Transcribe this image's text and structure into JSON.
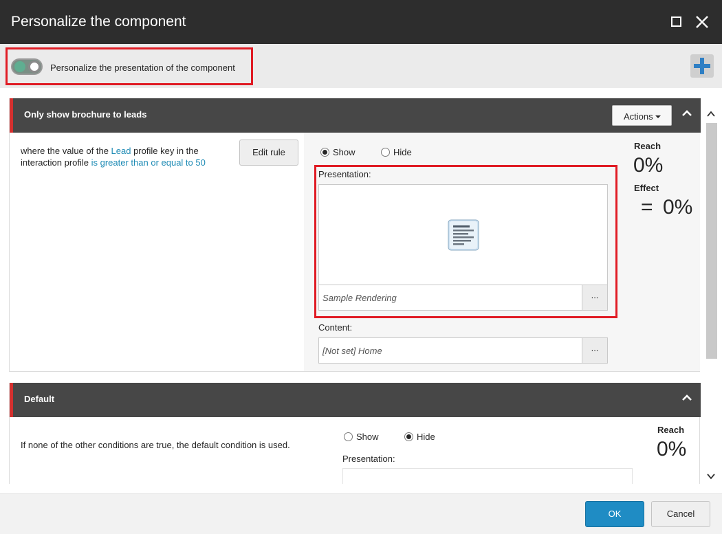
{
  "dialog": {
    "title": "Personalize the component",
    "maximize_icon": "maximize-icon",
    "close_icon": "close-icon"
  },
  "toolbar": {
    "toggle_label": "Personalize the presentation of the component",
    "toggle_on": true,
    "add_icon": "plus-icon"
  },
  "rules": [
    {
      "title": "Only show brochure to leads",
      "actions_label": "Actions",
      "condition": {
        "prefix": "where the value of the ",
        "key": "Lead",
        "middle": " profile key in the interaction profile ",
        "operator": "is greater than or equal to 50"
      },
      "edit_rule_label": "Edit rule",
      "show_label": "Show",
      "hide_label": "Hide",
      "selected": "show",
      "presentation_label": "Presentation:",
      "presentation_value": "Sample Rendering",
      "content_label": "Content:",
      "content_value": "[Not set] Home",
      "browse_label": "...",
      "reach_label": "Reach",
      "reach_value": "0%",
      "effect_label": "Effect",
      "effect_symbol": "=",
      "effect_value": "0%"
    },
    {
      "title": "Default",
      "condition_text": "If none of the other conditions are true, the default condition is used.",
      "show_label": "Show",
      "hide_label": "Hide",
      "selected": "hide",
      "presentation_label": "Presentation:",
      "reach_label": "Reach",
      "reach_value": "0%"
    }
  ],
  "footer": {
    "ok_label": "OK",
    "cancel_label": "Cancel"
  },
  "colors": {
    "titlebar": "#2d2d2d",
    "rule_header": "#474747",
    "rule_accent": "#d4302f",
    "highlight_box": "#e01b24",
    "link": "#1e8bb5",
    "ok_button": "#1f8cc4",
    "plus_icon": "#2f7fc4"
  }
}
